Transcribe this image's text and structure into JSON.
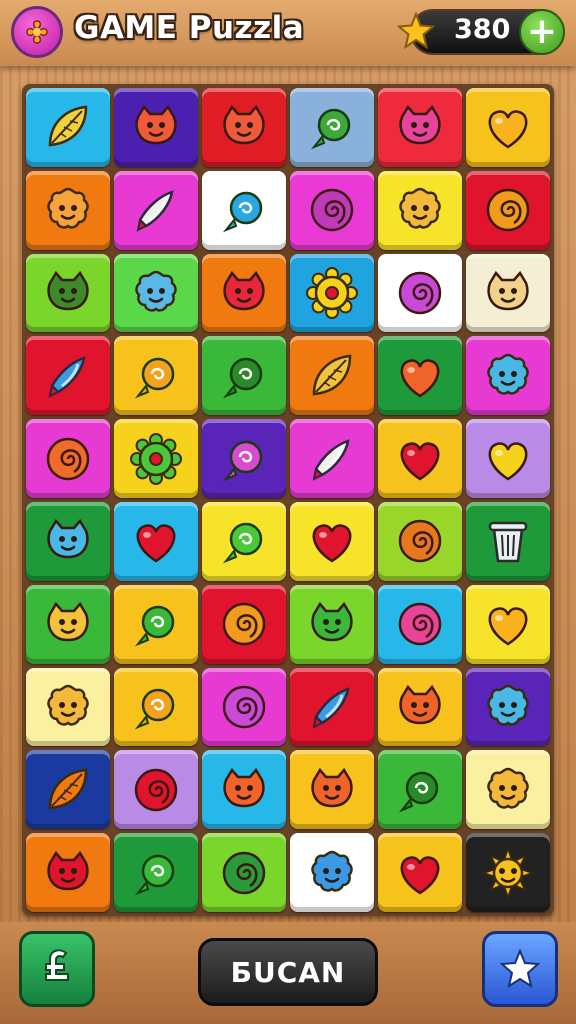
{
  "header": {
    "title": "GAME Puzzla",
    "score": "380",
    "add_label": "+",
    "logo_icon": "flower-badge-icon",
    "score_icon": "star-coin-icon"
  },
  "board": {
    "rows": 10,
    "cols": 6,
    "tiles": [
      [
        {
          "bg": "#27b7e8",
          "icon": "leaf",
          "fg": "#f2d23a"
        },
        {
          "bg": "#4b1fb0",
          "icon": "cat",
          "fg": "#ef5a3a"
        },
        {
          "bg": "#e01c24",
          "icon": "cat",
          "fg": "#f05a3a"
        },
        {
          "bg": "#8ab0dc",
          "icon": "candy",
          "fg": "#3ea83a"
        },
        {
          "bg": "#ee2a3c",
          "icon": "cat",
          "fg": "#e8449a"
        },
        {
          "bg": "#f6c21c",
          "icon": "heart",
          "fg": "#f7b21e"
        }
      ],
      [
        {
          "bg": "#f07a10",
          "icon": "blob",
          "fg": "#f7a23a"
        },
        {
          "bg": "#e63ad2",
          "icon": "rocket",
          "fg": "#f0f0f0"
        },
        {
          "bg": "#ffffff",
          "icon": "candy",
          "fg": "#2aa6e0"
        },
        {
          "bg": "#ea3ad6",
          "icon": "swirl",
          "fg": "#c03ab8"
        },
        {
          "bg": "#f7e42a",
          "icon": "blob",
          "fg": "#f2b93a"
        },
        {
          "bg": "#e0142c",
          "icon": "swirl",
          "fg": "#f09a1e"
        }
      ],
      [
        {
          "bg": "#7ad62a",
          "icon": "cat",
          "fg": "#3e8a2a"
        },
        {
          "bg": "#5ad84a",
          "icon": "blob",
          "fg": "#5ab8e6"
        },
        {
          "bg": "#f07a10",
          "icon": "cat",
          "fg": "#e8283a"
        },
        {
          "bg": "#1fa4e0",
          "icon": "gear",
          "fg": "#f7d21c"
        },
        {
          "bg": "#ffffff",
          "icon": "swirl",
          "fg": "#c84ad6"
        },
        {
          "bg": "#f4efd4",
          "icon": "cat",
          "fg": "#f2d28a"
        }
      ],
      [
        {
          "bg": "#e0142c",
          "icon": "rocket",
          "fg": "#3a9ae6"
        },
        {
          "bg": "#f7c21c",
          "icon": "candy",
          "fg": "#f2a21c"
        },
        {
          "bg": "#3ab83a",
          "icon": "candy",
          "fg": "#2a8a2a"
        },
        {
          "bg": "#f07a10",
          "icon": "leaf",
          "fg": "#f2c23a"
        },
        {
          "bg": "#1e9a3a",
          "icon": "heart",
          "fg": "#f0642a"
        },
        {
          "bg": "#e63ad2",
          "icon": "blob",
          "fg": "#4ab8e6"
        }
      ],
      [
        {
          "bg": "#e63ad2",
          "icon": "swirl",
          "fg": "#f06a2a"
        },
        {
          "bg": "#f7d21c",
          "icon": "gear",
          "fg": "#4ac83a"
        },
        {
          "bg": "#5a24b8",
          "icon": "candy",
          "fg": "#d84ad0"
        },
        {
          "bg": "#e63ad2",
          "icon": "rocket",
          "fg": "#f0f0f0"
        },
        {
          "bg": "#f6c21c",
          "icon": "heart",
          "fg": "#e0142c"
        },
        {
          "bg": "#b98ae6",
          "icon": "heart",
          "fg": "#f7d21c"
        }
      ],
      [
        {
          "bg": "#1e9a3a",
          "icon": "cat",
          "fg": "#4ab8e6"
        },
        {
          "bg": "#27b7e8",
          "icon": "heart",
          "fg": "#e0142c"
        },
        {
          "bg": "#f7e42a",
          "icon": "candy",
          "fg": "#4ac83a"
        },
        {
          "bg": "#f7e42a",
          "icon": "heart",
          "fg": "#e0142c"
        },
        {
          "bg": "#9ad62a",
          "icon": "swirl",
          "fg": "#e8781e"
        },
        {
          "bg": "#1e9a3a",
          "icon": "trash",
          "fg": "#e8f0f6"
        }
      ],
      [
        {
          "bg": "#3ab83a",
          "icon": "cat",
          "fg": "#f2c23a"
        },
        {
          "bg": "#f7c21c",
          "icon": "candy",
          "fg": "#3ab83a"
        },
        {
          "bg": "#e0142c",
          "icon": "swirl",
          "fg": "#f09a1e"
        },
        {
          "bg": "#7ad62a",
          "icon": "cat",
          "fg": "#3ab83a"
        },
        {
          "bg": "#27b7e8",
          "icon": "swirl",
          "fg": "#e8449a"
        },
        {
          "bg": "#f7e42a",
          "icon": "heart",
          "fg": "#f7b21e"
        }
      ],
      [
        {
          "bg": "#faf0a0",
          "icon": "blob",
          "fg": "#f2b93a"
        },
        {
          "bg": "#f7c21c",
          "icon": "candy",
          "fg": "#f2a21c"
        },
        {
          "bg": "#e63ad2",
          "icon": "swirl",
          "fg": "#c84ad6"
        },
        {
          "bg": "#e0142c",
          "icon": "rocket",
          "fg": "#3a9ae6"
        },
        {
          "bg": "#f7c21c",
          "icon": "cat",
          "fg": "#f0642a"
        },
        {
          "bg": "#5a24b8",
          "icon": "blob",
          "fg": "#4ab8e6"
        }
      ],
      [
        {
          "bg": "#1a3aa0",
          "icon": "leaf",
          "fg": "#f07a10"
        },
        {
          "bg": "#b98ae6",
          "icon": "swirl",
          "fg": "#e0142c"
        },
        {
          "bg": "#27b7e8",
          "icon": "cat",
          "fg": "#f0642a"
        },
        {
          "bg": "#f7c21c",
          "icon": "cat",
          "fg": "#f0642a"
        },
        {
          "bg": "#3ab83a",
          "icon": "candy",
          "fg": "#2a8a2a"
        },
        {
          "bg": "#faf0a0",
          "icon": "blob",
          "fg": "#f2b93a"
        }
      ],
      [
        {
          "bg": "#f07a10",
          "icon": "cat",
          "fg": "#e0142c"
        },
        {
          "bg": "#1e9a3a",
          "icon": "candy",
          "fg": "#3ab83a"
        },
        {
          "bg": "#7ad62a",
          "icon": "swirl",
          "fg": "#2a9a3a"
        },
        {
          "bg": "#ffffff",
          "icon": "blob",
          "fg": "#3a9ae6"
        },
        {
          "bg": "#f6c21c",
          "icon": "heart",
          "fg": "#e0142c"
        },
        {
          "bg": "#222222",
          "icon": "sun",
          "fg": "#f7c21c"
        }
      ]
    ]
  },
  "footer": {
    "main_label": "БUCAN",
    "left_icon": "undo-puzzle-icon",
    "right_icon": "star-icon"
  }
}
